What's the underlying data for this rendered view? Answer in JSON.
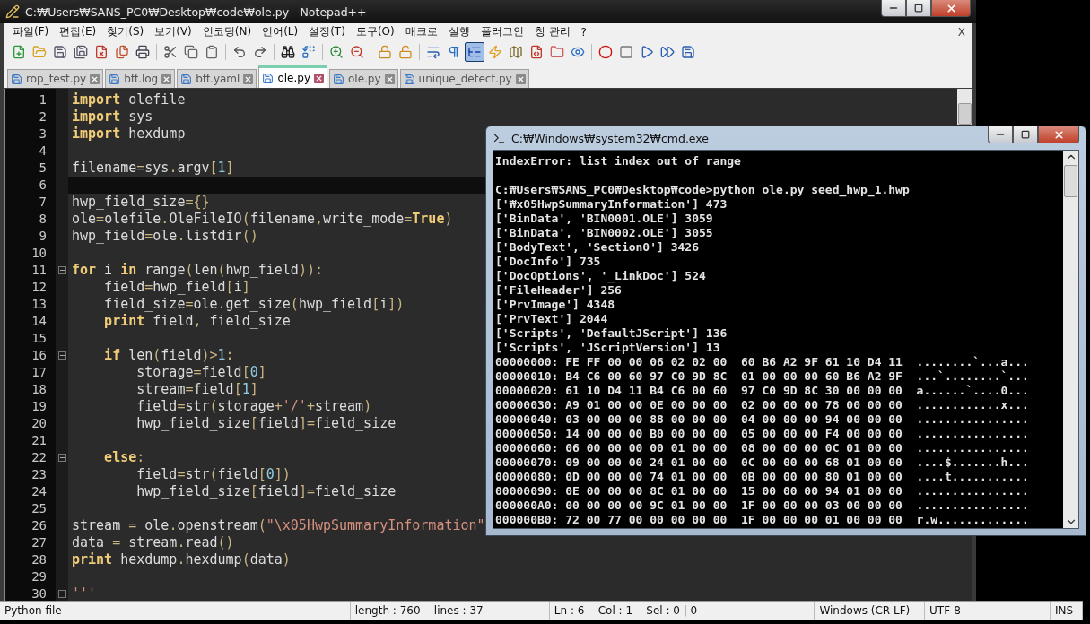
{
  "window": {
    "title": "C:₩Users₩SANS_PC0₩Desktop₩code₩ole.py - Notepad++"
  },
  "menu": [
    "파일(F)",
    "편집(E)",
    "찾기(S)",
    "보기(V)",
    "인코딩(N)",
    "언어(L)",
    "설정(T)",
    "도구(O)",
    "매크로",
    "실행",
    "플러그인",
    "창 관리",
    "?"
  ],
  "menu_close": "X",
  "toolbar": [
    {
      "kind": "new",
      "pressed": false
    },
    {
      "kind": "open",
      "pressed": false
    },
    {
      "kind": "save",
      "pressed": false
    },
    {
      "kind": "saveall",
      "pressed": false
    },
    {
      "kind": "close",
      "pressed": false
    },
    {
      "kind": "closeall",
      "pressed": false
    },
    {
      "kind": "print",
      "pressed": false
    },
    {
      "kind": "separator"
    },
    {
      "kind": "cut",
      "pressed": false
    },
    {
      "kind": "copy",
      "pressed": false
    },
    {
      "kind": "paste",
      "pressed": false
    },
    {
      "kind": "separator"
    },
    {
      "kind": "undo",
      "pressed": false
    },
    {
      "kind": "redo",
      "pressed": false
    },
    {
      "kind": "separator"
    },
    {
      "kind": "find",
      "pressed": false
    },
    {
      "kind": "replace",
      "pressed": false
    },
    {
      "kind": "separator"
    },
    {
      "kind": "zoomin",
      "pressed": false
    },
    {
      "kind": "zoomout",
      "pressed": false
    },
    {
      "kind": "separator"
    },
    {
      "kind": "syncv",
      "pressed": false
    },
    {
      "kind": "synch",
      "pressed": false
    },
    {
      "kind": "separator"
    },
    {
      "kind": "wrap",
      "pressed": false
    },
    {
      "kind": "allchars",
      "pressed": false
    },
    {
      "kind": "indent",
      "pressed": true
    },
    {
      "kind": "lang",
      "pressed": false
    },
    {
      "kind": "map",
      "pressed": false
    },
    {
      "kind": "function",
      "pressed": false
    },
    {
      "kind": "folder",
      "pressed": false
    },
    {
      "kind": "monitor",
      "pressed": false
    },
    {
      "kind": "separator"
    },
    {
      "kind": "record",
      "pressed": false
    },
    {
      "kind": "stop",
      "pressed": false
    },
    {
      "kind": "play",
      "pressed": false
    },
    {
      "kind": "playmulti",
      "pressed": false
    },
    {
      "kind": "savemacro",
      "pressed": false
    }
  ],
  "tabs": [
    {
      "label": "rop_test.py",
      "selected": false
    },
    {
      "label": "bff.log",
      "selected": false
    },
    {
      "label": "bff.yaml",
      "selected": false
    },
    {
      "label": "ole.py",
      "selected": true
    },
    {
      "label": "ole.py",
      "selected": false
    },
    {
      "label": "unique_detect.py",
      "selected": false
    }
  ],
  "editor": {
    "lines": [
      {
        "number": "1",
        "current": false,
        "fold": false,
        "tokens": [
          {
            "kind": "kw",
            "text": "import"
          },
          {
            "kind": "id",
            "text": " olefile"
          }
        ]
      },
      {
        "number": "2",
        "current": false,
        "fold": false,
        "tokens": [
          {
            "kind": "kw",
            "text": "import"
          },
          {
            "kind": "id",
            "text": " sys"
          }
        ]
      },
      {
        "number": "3",
        "current": false,
        "fold": false,
        "tokens": [
          {
            "kind": "kw",
            "text": "import"
          },
          {
            "kind": "id",
            "text": " hexdump"
          }
        ]
      },
      {
        "number": "4",
        "current": false,
        "fold": false
      },
      {
        "number": "5",
        "current": false,
        "fold": false,
        "tokens": [
          {
            "kind": "id",
            "text": "filename"
          },
          {
            "kind": "op",
            "text": "="
          },
          {
            "kind": "id",
            "text": "sys"
          },
          {
            "kind": "op",
            "text": "."
          },
          {
            "kind": "id",
            "text": "argv"
          },
          {
            "kind": "op",
            "text": "["
          },
          {
            "kind": "num",
            "text": "1"
          },
          {
            "kind": "op",
            "text": "]"
          }
        ]
      },
      {
        "number": "6",
        "current": true,
        "fold": false
      },
      {
        "number": "7",
        "current": false,
        "fold": false,
        "tokens": [
          {
            "kind": "id",
            "text": "hwp_field_size"
          },
          {
            "kind": "op",
            "text": "={}"
          }
        ]
      },
      {
        "number": "8",
        "current": false,
        "fold": false,
        "tokens": [
          {
            "kind": "id",
            "text": "ole"
          },
          {
            "kind": "op",
            "text": "="
          },
          {
            "kind": "id",
            "text": "olefile"
          },
          {
            "kind": "op",
            "text": "."
          },
          {
            "kind": "id",
            "text": "OleFileIO"
          },
          {
            "kind": "op",
            "text": "("
          },
          {
            "kind": "id",
            "text": "filename"
          },
          {
            "kind": "op",
            "text": ","
          },
          {
            "kind": "id",
            "text": "write_mode"
          },
          {
            "kind": "op",
            "text": "="
          },
          {
            "kind": "kw",
            "text": "True"
          },
          {
            "kind": "op",
            "text": ")"
          }
        ]
      },
      {
        "number": "9",
        "current": false,
        "fold": false,
        "tokens": [
          {
            "kind": "id",
            "text": "hwp_field"
          },
          {
            "kind": "op",
            "text": "="
          },
          {
            "kind": "id",
            "text": "ole"
          },
          {
            "kind": "op",
            "text": "."
          },
          {
            "kind": "id",
            "text": "listdir"
          },
          {
            "kind": "op",
            "text": "()"
          }
        ]
      },
      {
        "number": "10",
        "current": false,
        "fold": false
      },
      {
        "number": "11",
        "current": false,
        "fold": true,
        "tokens": [
          {
            "kind": "kw",
            "text": "for"
          },
          {
            "kind": "id",
            "text": " i "
          },
          {
            "kind": "kw",
            "text": "in"
          },
          {
            "kind": "id",
            "text": " range"
          },
          {
            "kind": "op",
            "text": "("
          },
          {
            "kind": "id",
            "text": "len"
          },
          {
            "kind": "op",
            "text": "("
          },
          {
            "kind": "id",
            "text": "hwp_field"
          },
          {
            "kind": "op",
            "text": ")):"
          }
        ]
      },
      {
        "number": "12",
        "current": false,
        "fold": false,
        "tokens": [
          {
            "kind": "id",
            "text": "    field"
          },
          {
            "kind": "op",
            "text": "="
          },
          {
            "kind": "id",
            "text": "hwp_field"
          },
          {
            "kind": "op",
            "text": "["
          },
          {
            "kind": "id",
            "text": "i"
          },
          {
            "kind": "op",
            "text": "]"
          }
        ]
      },
      {
        "number": "13",
        "current": false,
        "fold": false,
        "tokens": [
          {
            "kind": "id",
            "text": "    field_size"
          },
          {
            "kind": "op",
            "text": "="
          },
          {
            "kind": "id",
            "text": "ole"
          },
          {
            "kind": "op",
            "text": "."
          },
          {
            "kind": "id",
            "text": "get_size"
          },
          {
            "kind": "op",
            "text": "("
          },
          {
            "kind": "id",
            "text": "hwp_field"
          },
          {
            "kind": "op",
            "text": "["
          },
          {
            "kind": "id",
            "text": "i"
          },
          {
            "kind": "op",
            "text": "])"
          }
        ]
      },
      {
        "number": "14",
        "current": false,
        "fold": false,
        "tokens": [
          {
            "kind": "kw",
            "text": "    print"
          },
          {
            "kind": "id",
            "text": " field"
          },
          {
            "kind": "op",
            "text": ","
          },
          {
            "kind": "id",
            "text": " field_size"
          }
        ]
      },
      {
        "number": "15",
        "current": false,
        "fold": false
      },
      {
        "number": "16",
        "current": false,
        "fold": true,
        "tokens": [
          {
            "kind": "kw",
            "text": "    if"
          },
          {
            "kind": "id",
            "text": " len"
          },
          {
            "kind": "op",
            "text": "("
          },
          {
            "kind": "id",
            "text": "field"
          },
          {
            "kind": "op",
            "text": ")>"
          },
          {
            "kind": "num",
            "text": "1"
          },
          {
            "kind": "op",
            "text": ":"
          }
        ]
      },
      {
        "number": "17",
        "current": false,
        "fold": false,
        "tokens": [
          {
            "kind": "id",
            "text": "        storage"
          },
          {
            "kind": "op",
            "text": "="
          },
          {
            "kind": "id",
            "text": "field"
          },
          {
            "kind": "op",
            "text": "["
          },
          {
            "kind": "num",
            "text": "0"
          },
          {
            "kind": "op",
            "text": "]"
          }
        ]
      },
      {
        "number": "18",
        "current": false,
        "fold": false,
        "tokens": [
          {
            "kind": "id",
            "text": "        stream"
          },
          {
            "kind": "op",
            "text": "="
          },
          {
            "kind": "id",
            "text": "field"
          },
          {
            "kind": "op",
            "text": "["
          },
          {
            "kind": "num",
            "text": "1"
          },
          {
            "kind": "op",
            "text": "]"
          }
        ]
      },
      {
        "number": "19",
        "current": false,
        "fold": false,
        "tokens": [
          {
            "kind": "id",
            "text": "        field"
          },
          {
            "kind": "op",
            "text": "="
          },
          {
            "kind": "id",
            "text": "str"
          },
          {
            "kind": "op",
            "text": "("
          },
          {
            "kind": "id",
            "text": "storage"
          },
          {
            "kind": "op",
            "text": "+"
          },
          {
            "kind": "str",
            "text": "'/'"
          },
          {
            "kind": "op",
            "text": "+"
          },
          {
            "kind": "id",
            "text": "stream"
          },
          {
            "kind": "op",
            "text": ")"
          }
        ]
      },
      {
        "number": "20",
        "current": false,
        "fold": false,
        "tokens": [
          {
            "kind": "id",
            "text": "        hwp_field_size"
          },
          {
            "kind": "op",
            "text": "["
          },
          {
            "kind": "id",
            "text": "field"
          },
          {
            "kind": "op",
            "text": "]="
          },
          {
            "kind": "id",
            "text": "field_size"
          }
        ]
      },
      {
        "number": "21",
        "current": false,
        "fold": false
      },
      {
        "number": "22",
        "current": false,
        "fold": true,
        "tokens": [
          {
            "kind": "kw",
            "text": "    else"
          },
          {
            "kind": "op",
            "text": ":"
          }
        ]
      },
      {
        "number": "23",
        "current": false,
        "fold": false,
        "tokens": [
          {
            "kind": "id",
            "text": "        field"
          },
          {
            "kind": "op",
            "text": "="
          },
          {
            "kind": "id",
            "text": "str"
          },
          {
            "kind": "op",
            "text": "("
          },
          {
            "kind": "id",
            "text": "field"
          },
          {
            "kind": "op",
            "text": "["
          },
          {
            "kind": "num",
            "text": "0"
          },
          {
            "kind": "op",
            "text": "])"
          }
        ]
      },
      {
        "number": "24",
        "current": false,
        "fold": false,
        "tokens": [
          {
            "kind": "id",
            "text": "        hwp_field_size"
          },
          {
            "kind": "op",
            "text": "["
          },
          {
            "kind": "id",
            "text": "field"
          },
          {
            "kind": "op",
            "text": "]="
          },
          {
            "kind": "id",
            "text": "field_size"
          }
        ]
      },
      {
        "number": "25",
        "current": false,
        "fold": false
      },
      {
        "number": "26",
        "current": false,
        "fold": false,
        "tokens": [
          {
            "kind": "id",
            "text": "stream "
          },
          {
            "kind": "op",
            "text": "="
          },
          {
            "kind": "id",
            "text": " ole"
          },
          {
            "kind": "op",
            "text": "."
          },
          {
            "kind": "id",
            "text": "openstream"
          },
          {
            "kind": "op",
            "text": "("
          },
          {
            "kind": "str",
            "text": "\"\\x05HwpSummaryInformation\""
          }
        ]
      },
      {
        "number": "27",
        "current": false,
        "fold": false,
        "tokens": [
          {
            "kind": "id",
            "text": "data "
          },
          {
            "kind": "op",
            "text": "="
          },
          {
            "kind": "id",
            "text": " stream"
          },
          {
            "kind": "op",
            "text": "."
          },
          {
            "kind": "id",
            "text": "read"
          },
          {
            "kind": "op",
            "text": "()"
          }
        ]
      },
      {
        "number": "28",
        "current": false,
        "fold": false,
        "tokens": [
          {
            "kind": "kw",
            "text": "print"
          },
          {
            "kind": "id",
            "text": " hexdump"
          },
          {
            "kind": "op",
            "text": "."
          },
          {
            "kind": "id",
            "text": "hexdump"
          },
          {
            "kind": "op",
            "text": "("
          },
          {
            "kind": "id",
            "text": "data"
          },
          {
            "kind": "op",
            "text": ")"
          }
        ]
      },
      {
        "number": "29",
        "current": false,
        "fold": false
      },
      {
        "number": "30",
        "current": false,
        "fold": true,
        "tokens": [
          {
            "kind": "str",
            "text": "'''"
          }
        ]
      }
    ]
  },
  "status_bar": [
    "Python file",
    "length : 760    lines : 37",
    "Ln : 6    Col : 1    Sel : 0 | 0",
    "Windows (CR LF)",
    "UTF-8",
    "INS"
  ],
  "console": {
    "title": "C:₩Windows₩system32₩cmd.exe",
    "blocks": [
      [
        "IndexError: list index out of range"
      ],
      [
        "C:₩Users₩SANS_PC0₩Desktop₩code>python ole.py seed_hwp_1.hwp",
        "['₩x05HwpSummaryInformation'] 473",
        "['BinData', 'BIN0001.OLE'] 3059",
        "['BinData', 'BIN0002.OLE'] 3055",
        "['BodyText', 'Section0'] 3426",
        "['DocInfo'] 735",
        "['DocOptions', '_LinkDoc'] 524",
        "['FileHeader'] 256",
        "['PrvImage'] 4348",
        "['PrvText'] 2044",
        "['Scripts', 'DefaultJScript'] 136",
        "['Scripts', 'JScriptVersion'] 13",
        "00000000: FE FF 00 00 06 02 02 00  60 B6 A2 9F 61 10 D4 11  ........`...a...",
        "00000010: B4 C6 00 60 97 C0 9D 8C  01 00 00 00 60 B6 A2 9F  ...`........`...",
        "00000020: 61 10 D4 11 B4 C6 00 60  97 C0 9D 8C 30 00 00 00  a......`....0...",
        "00000030: A9 01 00 00 0E 00 00 00  02 00 00 00 78 00 00 00  ............x...",
        "00000040: 03 00 00 00 88 00 00 00  04 00 00 00 94 00 00 00  ................",
        "00000050: 14 00 00 00 B0 00 00 00  05 00 00 00 F4 00 00 00  ................",
        "00000060: 06 00 00 00 00 01 00 00  08 00 00 00 0C 01 00 00  ................",
        "00000070: 09 00 00 00 24 01 00 00  0C 00 00 00 68 01 00 00  ....$.......h...",
        "00000080: 0D 00 00 00 74 01 00 00  0B 00 00 00 80 01 00 00  ....t...........",
        "00000090: 0E 00 00 00 8C 01 00 00  15 00 00 00 94 01 00 00  ................",
        "000000A0: 00 00 00 00 9C 01 00 00  1F 00 00 00 03 00 00 00  ................",
        "000000B0: 72 00 77 00 00 00 00 00  1F 00 00 00 01 00 00 00  r.w............."
      ]
    ]
  }
}
